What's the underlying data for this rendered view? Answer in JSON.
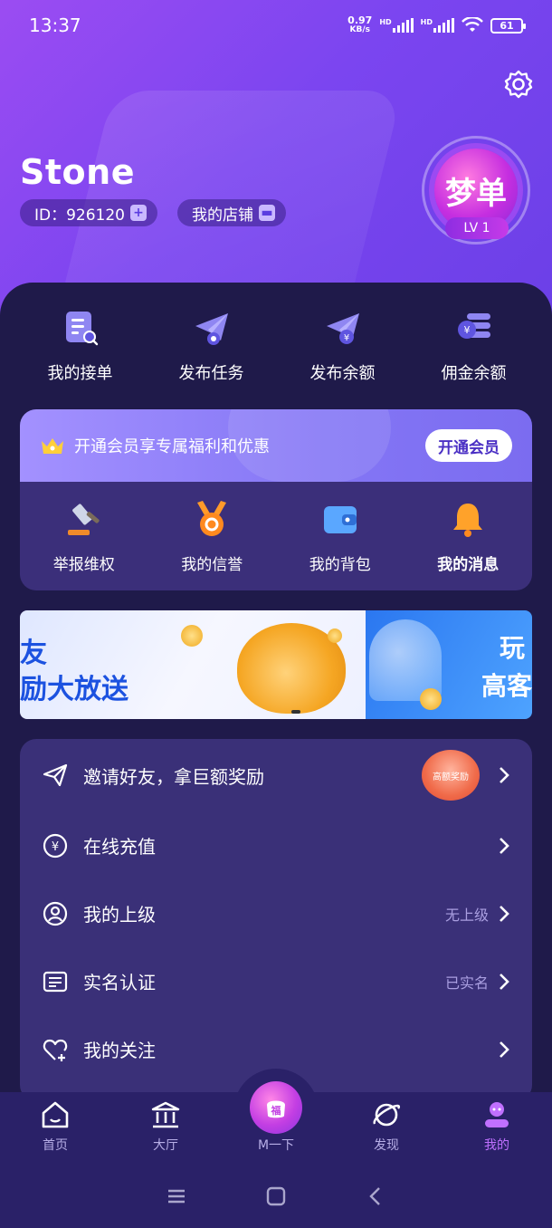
{
  "status_bar": {
    "time": "13:37",
    "net_speed_value": "0.97",
    "net_speed_unit": "KB/s",
    "hd1": "HD",
    "hd2": "HD",
    "battery": "61"
  },
  "profile": {
    "name": "Stone",
    "id_label": "ID：926120",
    "id_plus": "+",
    "shop_label": "我的店铺",
    "avatar_text": "梦单",
    "level": "LV 1"
  },
  "quick_actions": [
    {
      "label": "我的接单",
      "icon": "order-list-icon"
    },
    {
      "label": "发布任务",
      "icon": "paper-plane-icon"
    },
    {
      "label": "发布余额",
      "icon": "paper-plane-yuan-icon"
    },
    {
      "label": "佣金余额",
      "icon": "coin-stack-icon"
    }
  ],
  "vip": {
    "text": "开通会员享专属福利和优惠",
    "button": "开通会员",
    "items": [
      {
        "label": "举报维权",
        "icon": "gavel-icon"
      },
      {
        "label": "我的信誉",
        "icon": "medal-icon"
      },
      {
        "label": "我的背包",
        "icon": "wallet-icon"
      },
      {
        "label": "我的消息",
        "icon": "bell-icon"
      }
    ]
  },
  "banner": {
    "a_line1": "友",
    "a_line2": "励大放送",
    "b_line1": "玩",
    "b_line2": "高客"
  },
  "menu": {
    "items": [
      {
        "label": "邀请好友，拿巨额奖励",
        "value": "",
        "icon": "send-icon"
      },
      {
        "label": "在线充值",
        "value": "",
        "icon": "yuan-circle-icon"
      },
      {
        "label": "我的上级",
        "value": "无上级",
        "icon": "user-circle-icon"
      },
      {
        "label": "实名认证",
        "value": "已实名",
        "icon": "id-card-icon"
      },
      {
        "label": "我的关注",
        "value": "",
        "icon": "heart-plus-icon"
      }
    ],
    "reward_badge": "高额奖励"
  },
  "tabbar": {
    "tabs": [
      {
        "label": "首页",
        "icon": "home-icon"
      },
      {
        "label": "大厅",
        "icon": "hall-icon"
      },
      {
        "label": "M一下",
        "icon": "fu-icon"
      },
      {
        "label": "发现",
        "icon": "planet-icon"
      },
      {
        "label": "我的",
        "icon": "profile-icon"
      }
    ],
    "fu_glyph": "福"
  },
  "colors": {
    "header_gradient_start": "#9b4cf2",
    "panel_bg": "#1f1a4a",
    "card_bg": "#3a3078",
    "active_tab": "#c070ff"
  }
}
